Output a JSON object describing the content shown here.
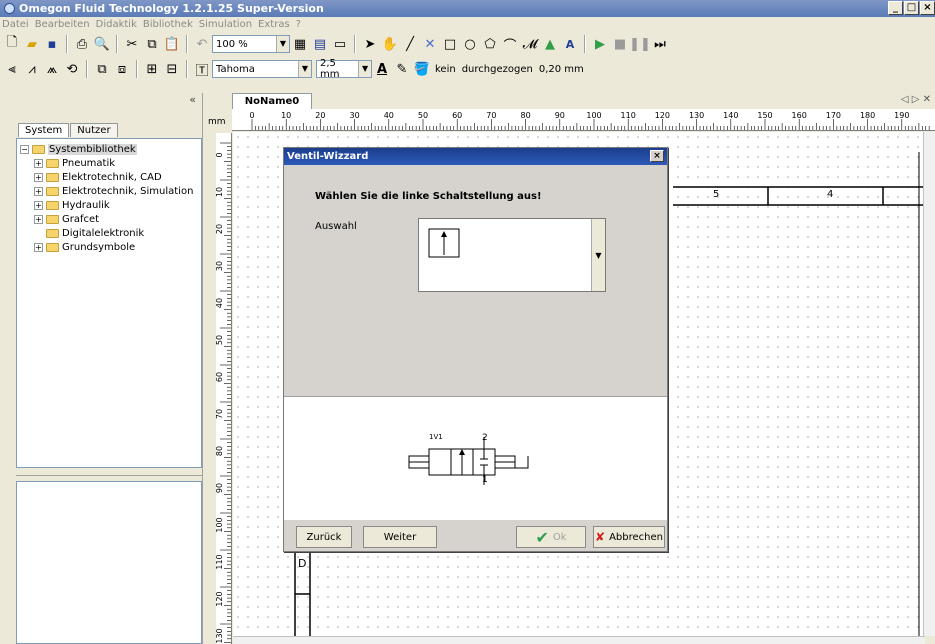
{
  "window": {
    "title": "Omegon Fluid Technology  1.2.1.25  Super-Version"
  },
  "menu": [
    "Datei",
    "Bearbeiten",
    "Didaktik",
    "Bibliothek",
    "Simulation",
    "Extras",
    "?"
  ],
  "toolbar": {
    "zoom": "100 %",
    "font": "Tahoma",
    "font_size": "2,5 mm",
    "line_style_none": "kein",
    "line_style": "durchgezogen",
    "line_width": "0,20 mm"
  },
  "left_panel": {
    "collapse": "«",
    "tabs": [
      "System",
      "Nutzer"
    ],
    "tree": [
      {
        "label": "Systembibliothek",
        "level": 0,
        "expander": "−"
      },
      {
        "label": "Pneumatik",
        "level": 1,
        "expander": "+"
      },
      {
        "label": "Elektrotechnik, CAD",
        "level": 1,
        "expander": "+"
      },
      {
        "label": "Elektrotechnik, Simulation",
        "level": 1,
        "expander": "+"
      },
      {
        "label": "Hydraulik",
        "level": 1,
        "expander": "+"
      },
      {
        "label": "Grafcet",
        "level": 1,
        "expander": "+"
      },
      {
        "label": "Digitalelektronik",
        "level": 1,
        "expander": ""
      },
      {
        "label": "Grundsymbole",
        "level": 1,
        "expander": "+"
      }
    ]
  },
  "document": {
    "tab": "NoName0",
    "nav": "◁ ▷ ✕",
    "unit": "mm",
    "ruler_h": [
      "0",
      "10",
      "20",
      "30",
      "40",
      "50",
      "60",
      "70",
      "80",
      "90",
      "100",
      "110",
      "120",
      "130",
      "140",
      "150",
      "160",
      "170",
      "180",
      "190"
    ],
    "ruler_v": [
      "0",
      "10",
      "20",
      "30",
      "40",
      "50",
      "60",
      "70",
      "80",
      "90",
      "100",
      "110",
      "120",
      "130"
    ],
    "frame_numbers": [
      "5",
      "4"
    ],
    "frame_letter": "D"
  },
  "dialog": {
    "title": "Ventil-Wizzard",
    "close": "×",
    "heading": "Wählen Sie die linke Schaltstellung aus!",
    "select_label": "Auswahl",
    "preview": {
      "label": "1V1",
      "port_top": "2",
      "port_bottom": "1"
    },
    "buttons": {
      "back": "Zurück",
      "next": "Weiter",
      "ok": "Ok",
      "cancel": "Abbrechen"
    }
  }
}
